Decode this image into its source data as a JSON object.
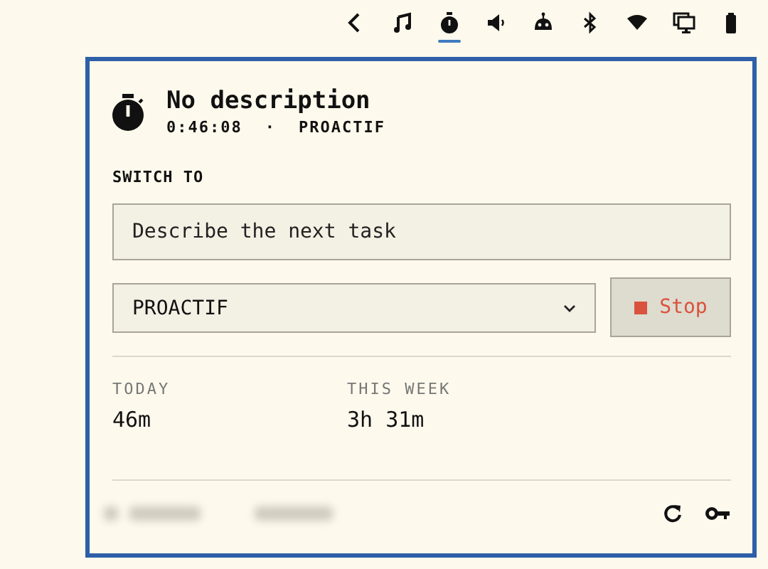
{
  "top_bar": [
    {
      "kind": "back",
      "selected": false
    },
    {
      "kind": "music",
      "selected": false
    },
    {
      "kind": "stopwatch",
      "selected": true
    },
    {
      "kind": "speaker",
      "selected": false
    },
    {
      "kind": "robot",
      "selected": false
    },
    {
      "kind": "bluetooth",
      "selected": false
    },
    {
      "kind": "wifi",
      "selected": false
    },
    {
      "kind": "display",
      "selected": false
    },
    {
      "kind": "battery",
      "selected": false
    }
  ],
  "current": {
    "title": "No description",
    "elapsed": "0:46:08",
    "separator": "·",
    "project": "PROACTIF"
  },
  "switch_to": {
    "label": "SWITCH TO",
    "placeholder": "Describe the next task",
    "project": "PROACTIF",
    "stop": "Stop"
  },
  "stats": [
    {
      "label": "TODAY",
      "value": "46m"
    },
    {
      "label": "THIS WEEK",
      "value": "3h 31m"
    }
  ],
  "footer": {
    "actions": [
      {
        "kind": "refresh"
      },
      {
        "kind": "key"
      }
    ]
  }
}
